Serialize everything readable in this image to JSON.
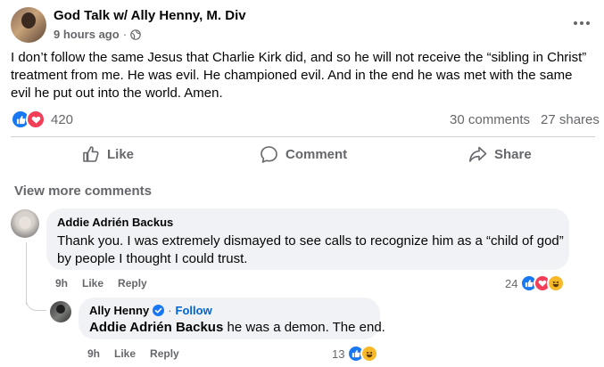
{
  "post": {
    "author": "God Talk w/ Ally Henny, M. Div",
    "time": "9 hours ago",
    "separator": "·",
    "body": "I don’t follow the same Jesus that Charlie Kirk did, and so he will not receive the “sibling in Christ” treatment from me. He was evil. He championed evil. And in the end he was met with the same evil he put out into the world. Amen.",
    "reaction_count": "420",
    "comments_count": "30 comments",
    "shares_count": "27 shares"
  },
  "actions": {
    "like": "Like",
    "comment": "Comment",
    "share": "Share"
  },
  "view_more": "View more comments",
  "comments": [
    {
      "author": "Addie Adrién Backus",
      "text": "Thank you. I was extremely dismayed to see calls to recognize him as a “child of god” by people I thought I could trust.",
      "time": "9h",
      "like": "Like",
      "reply": "Reply",
      "reactions": "24"
    },
    {
      "author": "Ally Henny",
      "follow": "Follow",
      "separator": "·",
      "mention": "Addie Adrién Backus",
      "text": " he was a demon. The end.",
      "time": "9h",
      "like": "Like",
      "reply": "Reply",
      "reactions": "13"
    }
  ],
  "colors": {
    "like_blue": "#1877f2",
    "love_red": "#f33e58",
    "haha_yellow": "#f7b928",
    "muted": "#65676b"
  }
}
